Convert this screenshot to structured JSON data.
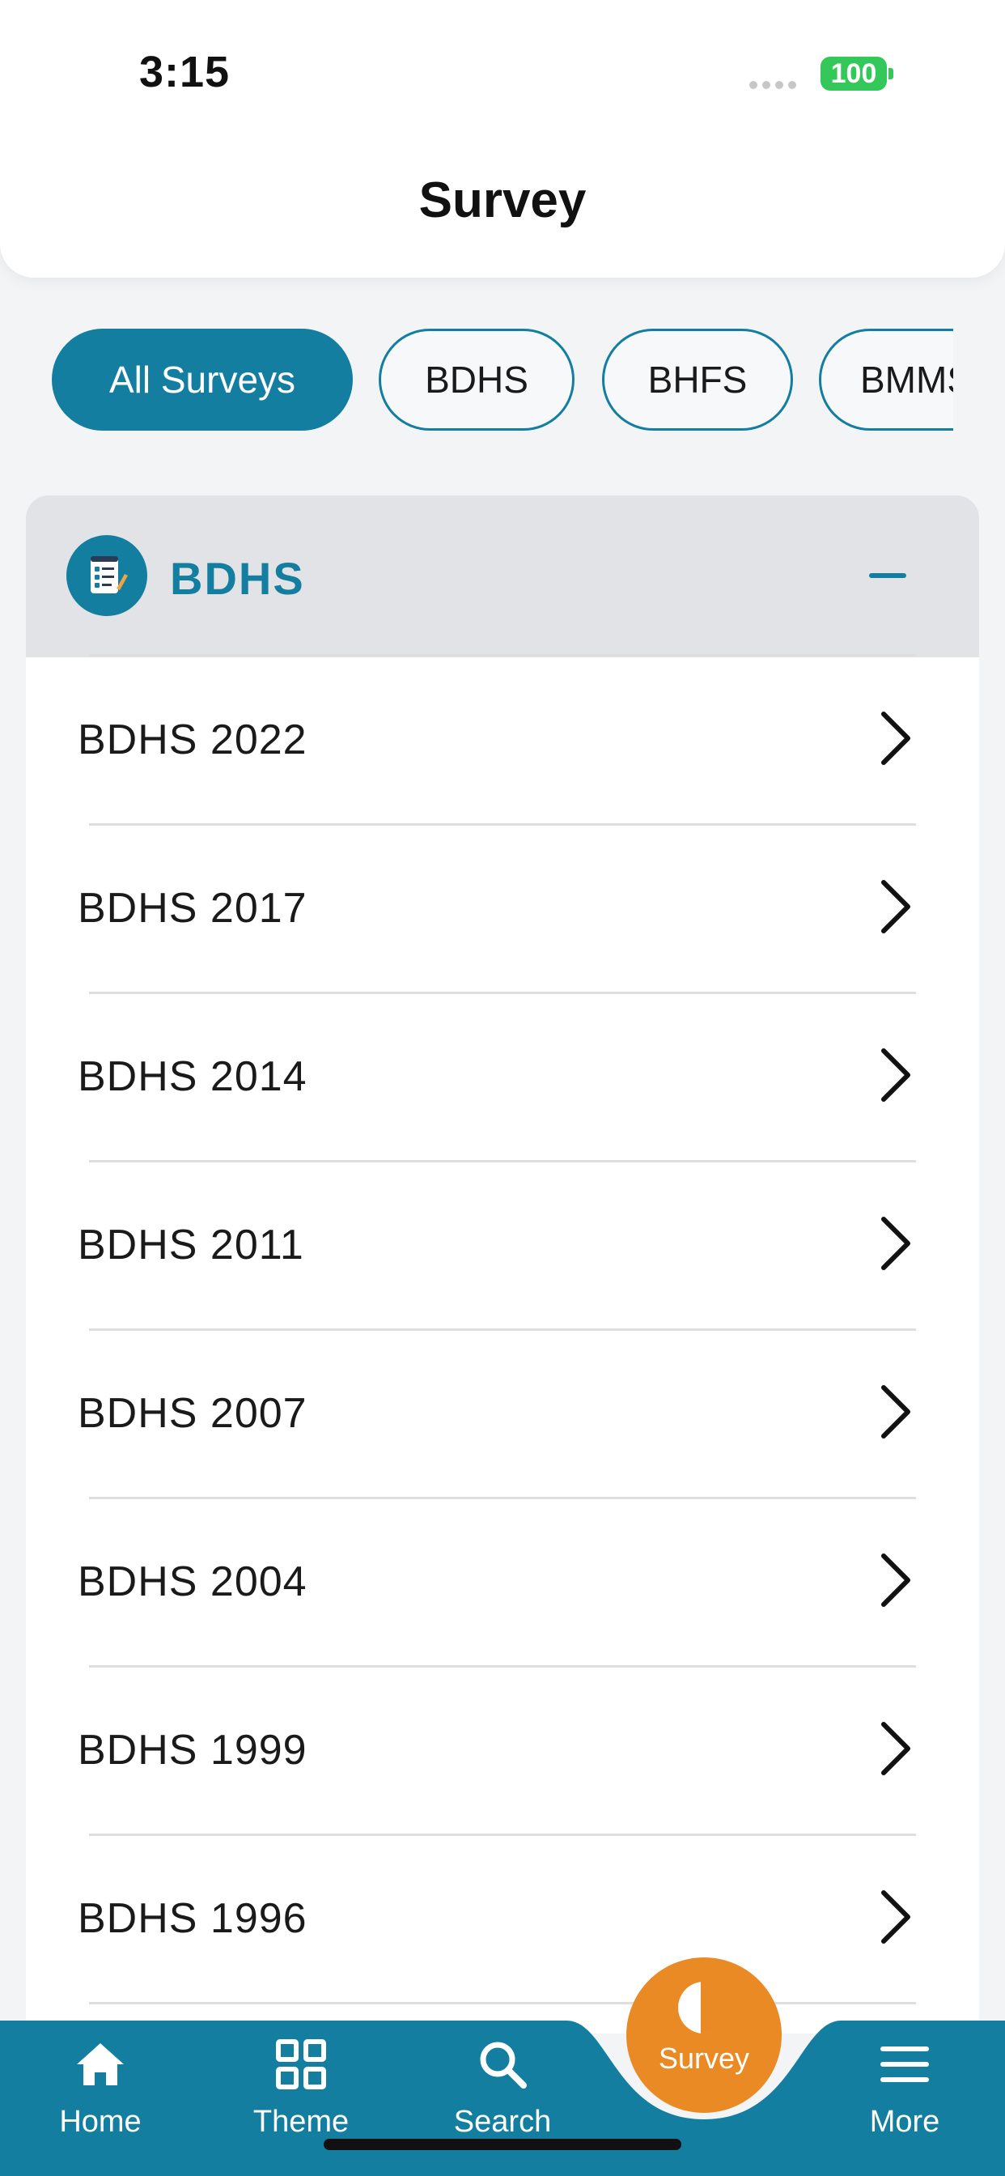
{
  "status_bar": {
    "time": "3:15",
    "battery": "100"
  },
  "header": {
    "title": "Survey"
  },
  "filters": [
    {
      "label": "All Surveys",
      "active": true
    },
    {
      "label": "BDHS",
      "active": false
    },
    {
      "label": "BHFS",
      "active": false
    },
    {
      "label": "BMMS",
      "active": false
    }
  ],
  "section": {
    "title": "BDHS",
    "icon": "survey-form-icon",
    "collapse_icon": "minus-icon",
    "items": [
      {
        "label": "BDHS 2022"
      },
      {
        "label": "BDHS 2017"
      },
      {
        "label": "BDHS 2014"
      },
      {
        "label": "BDHS 2011"
      },
      {
        "label": "BDHS 2007"
      },
      {
        "label": "BDHS 2004"
      },
      {
        "label": "BDHS 1999"
      },
      {
        "label": "BDHS 1996"
      }
    ]
  },
  "nav": {
    "items": [
      {
        "label": "Home",
        "icon": "home-icon"
      },
      {
        "label": "Theme",
        "icon": "grid-icon"
      },
      {
        "label": "Search",
        "icon": "search-icon"
      },
      {
        "label": "Survey",
        "icon": "pie-chart-icon",
        "active": true
      },
      {
        "label": "More",
        "icon": "menu-icon"
      }
    ]
  },
  "colors": {
    "accent": "#147ea0",
    "fab": "#e98a24",
    "battery": "#34c759"
  }
}
